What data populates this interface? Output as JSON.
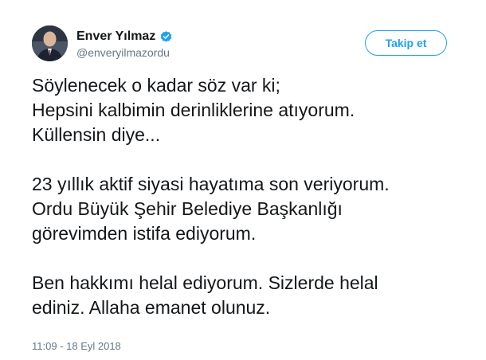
{
  "author": {
    "display_name": "Enver Yılmaz",
    "handle": "@enveryilmazordu",
    "verified": true
  },
  "follow_button": {
    "label": "Takip et"
  },
  "tweet": {
    "paragraphs": [
      [
        "Söylenecek o kadar söz var ki;",
        "Hepsini kalbimin derinliklerine atıyorum.",
        "Küllensin diye..."
      ],
      [
        "23 yıllık aktif siyasi hayatıma son veriyorum.",
        "Ordu Büyük Şehir Belediye Başkanlığı",
        "görevimden istifa ediyorum."
      ],
      [
        "Ben hakkımı helal ediyorum. Sizlerde helal",
        "ediniz. Allaha emanet olunuz."
      ]
    ],
    "timestamp": "11:09 - 18 Eyl 2018"
  },
  "colors": {
    "accent": "#1da1f2",
    "text": "#14171a",
    "secondary": "#657786"
  }
}
